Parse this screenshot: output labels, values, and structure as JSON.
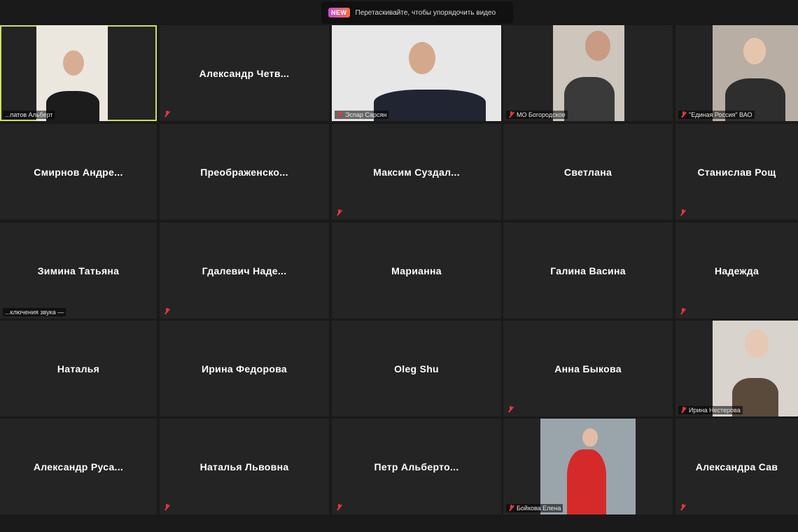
{
  "hint": {
    "badge": "NEW",
    "text": "Перетаскивайте, чтобы упорядочить видео"
  },
  "tiles": [
    {
      "name": "",
      "label": "...патов Альберт",
      "video": true,
      "active": true,
      "muted": false
    },
    {
      "name": "Александр  Четв...",
      "label": "",
      "video": false,
      "muted": true
    },
    {
      "name": "",
      "label": "Эспар Сарсян",
      "video": true,
      "muted": true
    },
    {
      "name": "",
      "label": "МО Богородское",
      "video": true,
      "muted": true
    },
    {
      "name": "",
      "label": "\"Единая Россия\" ВАО",
      "video": true,
      "muted": true
    },
    {
      "name": "Смирнов  Андре...",
      "label": "",
      "video": false,
      "muted": false
    },
    {
      "name": "Преображенско...",
      "label": "",
      "video": false,
      "muted": false
    },
    {
      "name": "Максим  Суздал...",
      "label": "",
      "video": false,
      "muted": true
    },
    {
      "name": "Светлана",
      "label": "",
      "video": false,
      "muted": false
    },
    {
      "name": "Станислав Рощ",
      "label": "",
      "video": false,
      "muted": true
    },
    {
      "name": "Зимина Татьяна",
      "label": "...ключения звука —",
      "video": false,
      "muted": false
    },
    {
      "name": "Гдалевич  Наде...",
      "label": "",
      "video": false,
      "muted": true
    },
    {
      "name": "Марианна",
      "label": "",
      "video": false,
      "muted": false
    },
    {
      "name": "Галина Васина",
      "label": "",
      "video": false,
      "muted": false
    },
    {
      "name": "Надежда",
      "label": "",
      "video": false,
      "muted": true
    },
    {
      "name": "Наталья",
      "label": "",
      "video": false,
      "muted": false
    },
    {
      "name": "Ирина Федорова",
      "label": "",
      "video": false,
      "muted": false
    },
    {
      "name": "Oleg Shu",
      "label": "",
      "video": false,
      "muted": false
    },
    {
      "name": "Анна Быкова",
      "label": "",
      "video": false,
      "muted": true
    },
    {
      "name": "",
      "label": "Ирина Нестерова",
      "video": true,
      "muted": true
    },
    {
      "name": "Александр  Руса...",
      "label": "",
      "video": false,
      "muted": false
    },
    {
      "name": "Наталья Львовна",
      "label": "",
      "video": false,
      "muted": true
    },
    {
      "name": "Петр  Альберто...",
      "label": "",
      "video": false,
      "muted": true
    },
    {
      "name": "",
      "label": "Бойкова Елена",
      "video": true,
      "muted": true
    },
    {
      "name": "Александра  Сав",
      "label": "",
      "video": false,
      "muted": true
    }
  ],
  "colors": {
    "active_border": "#c7e25e",
    "muted_mic": "#e5383b",
    "tile_bg": "#242424"
  }
}
